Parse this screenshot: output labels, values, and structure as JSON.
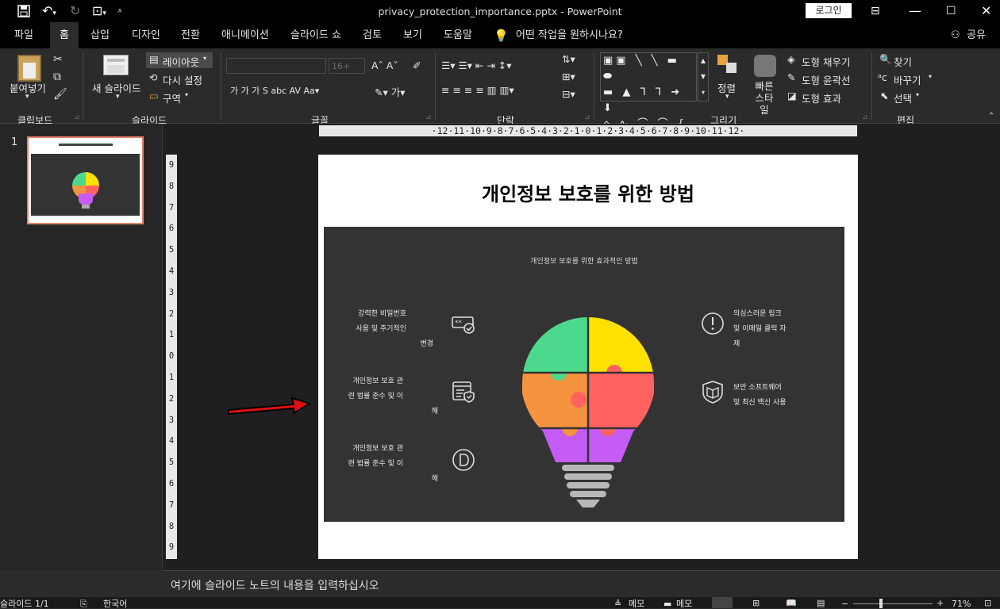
{
  "window": {
    "title": "privacy_protection_importance.pptx  -  PowerPoint",
    "login": "로그인"
  },
  "tabs": [
    "파일",
    "홈",
    "삽입",
    "디자인",
    "전환",
    "애니메이션",
    "슬라이드 쇼",
    "검토",
    "보기",
    "도움말"
  ],
  "active_tab": "홈",
  "tell_me": "어떤 작업을 원하시나요?",
  "share": "공유",
  "ribbon": {
    "paste": "붙여넣기",
    "new_slide": "새 슬라이드",
    "layout": "레이아웃",
    "reset": "다시 설정",
    "section": "구역",
    "font_size": "16+",
    "arrange": "정렬",
    "quick_styles": "빠른 스타일",
    "shape_fill": "도형 채우기",
    "shape_outline": "도형 윤곽선",
    "shape_effects": "도형 효과",
    "find": "찾기",
    "replace": "바꾸기",
    "select": "선택",
    "groups": {
      "clipboard": "클립보드",
      "slides": "슬라이드",
      "font": "글꼴",
      "paragraph": "단락",
      "drawing": "그리기",
      "editing": "편집"
    }
  },
  "thumbnail": {
    "number": "1"
  },
  "slide": {
    "title": "개인정보 보호를 위한 방법",
    "graphic_title": "개인정보 보호를 위한 효과적인 방법",
    "left_items": [
      {
        "lines": [
          "강력한 비밀번호",
          "사용 및 주기적인",
          "변경"
        ],
        "icon": "password-check-icon"
      },
      {
        "lines": [
          "개인정보 보호 관",
          "련 법률 준수 및 이",
          "해"
        ],
        "icon": "document-shield-icon"
      },
      {
        "lines": [
          "개인정보 보호 관",
          "련 법률 준수 및 이",
          "해"
        ],
        "icon": "d-circle-icon"
      }
    ],
    "right_items": [
      {
        "lines": [
          "의심스러운 링크",
          "및 이메일 클릭 자",
          "제"
        ],
        "icon": "exclamation-circle-icon"
      },
      {
        "lines": [
          "보안 소프트웨어",
          "및 최신 백신 사용"
        ],
        "icon": "shield-book-icon"
      }
    ],
    "puzzle_colors": {
      "green": "#4cd98e",
      "yellow": "#ffe100",
      "orange": "#f5933f",
      "red": "#ff625f",
      "purple": "#c45cf5",
      "base": "#b8b8b8"
    }
  },
  "notes_placeholder": "여기에 슬라이드 노트의 내용을 입력하십시오",
  "status": {
    "slide_count": "슬라이드 1/1",
    "language": "한국어",
    "notes": "메모",
    "comments": "메모",
    "zoom": "71%"
  }
}
